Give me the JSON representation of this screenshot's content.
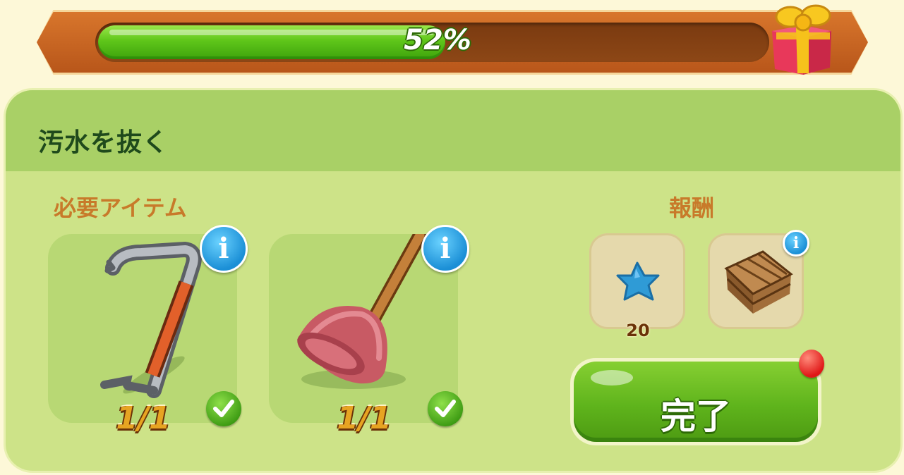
{
  "progress": {
    "value_percent": 52,
    "label": "52%"
  },
  "quest": {
    "title": "汚水を抜く"
  },
  "required": {
    "heading": "必要アイテム",
    "items": [
      {
        "icon": "crowbar-icon",
        "count": "1/1",
        "complete": true
      },
      {
        "icon": "plunger-icon",
        "count": "1/1",
        "complete": true
      }
    ]
  },
  "rewards": {
    "heading": "報酬",
    "items": [
      {
        "icon": "blue-star-icon",
        "count": "20"
      },
      {
        "icon": "wooden-crate-icon",
        "count": ""
      }
    ]
  },
  "actions": {
    "complete_label": "完了"
  },
  "colors": {
    "progress_fill": "#5fc61a",
    "panel": "#cde388",
    "header": "#a9d066",
    "button": "#5fb41c",
    "notification": "#e01818"
  }
}
